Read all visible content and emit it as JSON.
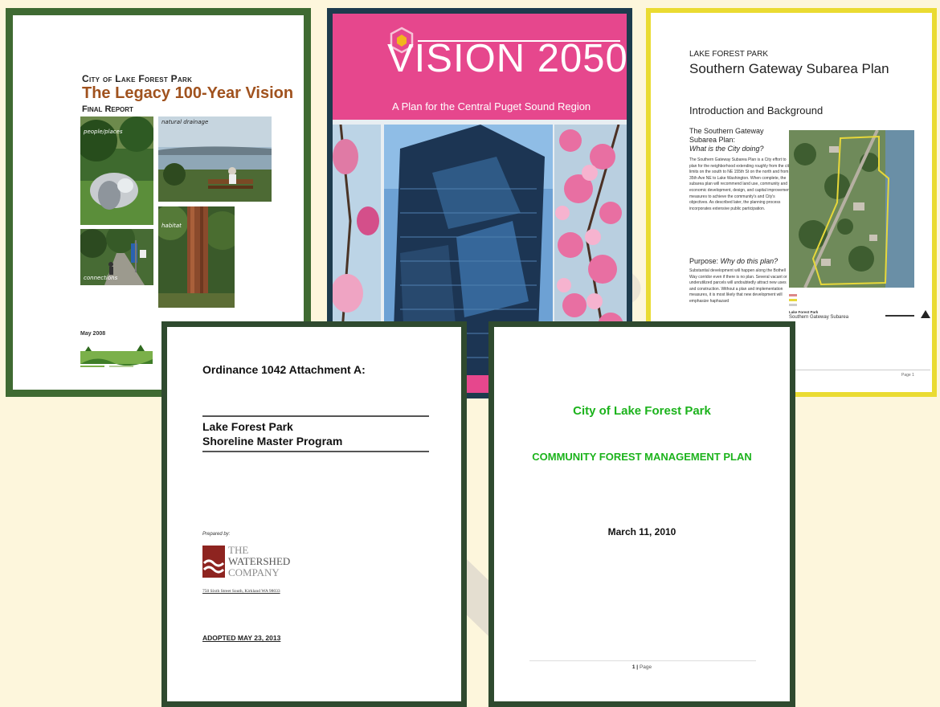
{
  "doc1": {
    "kicker": "City of Lake Forest Park",
    "title": "The Legacy 100-Year Vision",
    "subtitle": "Final Report",
    "photo_captions": [
      "people/places",
      "natural drainage",
      "habitat",
      "connections"
    ],
    "date": "May 2008",
    "logo_text": "LAKE FOREST PARK LEGACY"
  },
  "doc2": {
    "title": "VISION 2050",
    "tagline": "A Plan for the Central Puget Sound Region"
  },
  "doc3": {
    "kicker": "LAKE FOREST PARK",
    "title": "Southern Gateway Subarea Plan",
    "section": "Introduction and Background",
    "subhead": "The Southern Gateway Subarea Plan:",
    "subhead_question": "What is the City doing?",
    "body1": "The Southern Gateway Subarea Plan is a City effort to plan for the neighborhood extending roughly from the city limits on the south to NE 155th St on the north and from 35th Ave NE to Lake Washington. When complete, the subarea plan will recommend land use, community and economic development, design, and capital improvement measures to achieve the community's and City's objectives. As described later, the planning process incorporates extensive public participation.",
    "purpose_label": "Purpose:",
    "purpose_question": "Why do this plan?",
    "body2": "Substantial development will happen along the Bothell Way corridor even if there is no plan. Several vacant or underutilized parcels will undoubtedly attract new uses and construction. Without a plan and implementation measures, it is most likely that new development will emphasize haphazard",
    "map_caption_small": "Lake Forest Park",
    "map_caption": "Southern Gateway Subarea",
    "page": "Page 1"
  },
  "doc4": {
    "header": "Ordinance 1042 Attachment A:",
    "program_line1": "Lake Forest Park",
    "program_line2": "Shoreline Master Program",
    "prepared_by": "Prepared by:",
    "company_line1": "THE",
    "company_line2": "WATERSHED",
    "company_line3": "COMPANY",
    "address": "750 Sixth Street South, Kirkland WA 98033",
    "adopted": "ADOPTED MAY 23, 2013"
  },
  "doc5": {
    "city": "City of Lake Forest Park",
    "plan": "COMMUNITY FOREST MANAGEMENT PLAN",
    "date": "March 11, 2010",
    "page_num": "1",
    "page_sep": " | ",
    "page_word": "Page"
  },
  "colors": {
    "background": "#fdf6dc",
    "doc1_border": "#3f6a32",
    "doc2_border": "#1d3b4d",
    "doc3_border": "#eadb32",
    "doc45_border": "#2f4a2f",
    "vision_pink": "#e6478d",
    "forest_green_text": "#1cb31c",
    "legacy_title": "#a0521e"
  }
}
